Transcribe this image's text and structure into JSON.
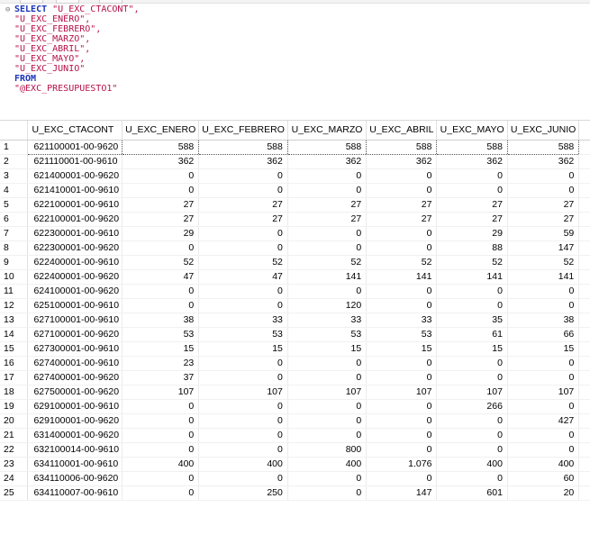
{
  "editor": {
    "lines": [
      {
        "kind": "select",
        "keyword": "SELECT",
        "text": "\"U_EXC_CTACONT\","
      },
      {
        "kind": "col",
        "text": "\"U_EXC_ENERO\","
      },
      {
        "kind": "col",
        "text": "\"U_EXC_FEBRERO\","
      },
      {
        "kind": "col",
        "text": "\"U_EXC_MARZO\","
      },
      {
        "kind": "col",
        "text": "\"U_EXC_ABRIL\","
      },
      {
        "kind": "col",
        "text": "\"U_EXC_MAYO\","
      },
      {
        "kind": "col",
        "text": "\"U_EXC_JUNIO\""
      },
      {
        "kind": "kw",
        "keyword": "FROM"
      },
      {
        "kind": "col",
        "text": "\"@EXC_PRESUPUESTO1\""
      }
    ]
  },
  "grid": {
    "columns": [
      "",
      "U_EXC_CTACONT",
      "U_EXC_ENERO",
      "U_EXC_FEBRERO",
      "U_EXC_MARZO",
      "U_EXC_ABRIL",
      "U_EXC_MAYO",
      "U_EXC_JUNIO"
    ],
    "rows": [
      [
        "1",
        "621100001-00-9620",
        "588",
        "588",
        "588",
        "588",
        "588",
        "588"
      ],
      [
        "2",
        "621110001-00-9610",
        "362",
        "362",
        "362",
        "362",
        "362",
        "362"
      ],
      [
        "3",
        "621400001-00-9620",
        "0",
        "0",
        "0",
        "0",
        "0",
        "0"
      ],
      [
        "4",
        "621410001-00-9610",
        "0",
        "0",
        "0",
        "0",
        "0",
        "0"
      ],
      [
        "5",
        "622100001-00-9610",
        "27",
        "27",
        "27",
        "27",
        "27",
        "27"
      ],
      [
        "6",
        "622100001-00-9620",
        "27",
        "27",
        "27",
        "27",
        "27",
        "27"
      ],
      [
        "7",
        "622300001-00-9610",
        "29",
        "0",
        "0",
        "0",
        "29",
        "59"
      ],
      [
        "8",
        "622300001-00-9620",
        "0",
        "0",
        "0",
        "0",
        "88",
        "147"
      ],
      [
        "9",
        "622400001-00-9610",
        "52",
        "52",
        "52",
        "52",
        "52",
        "52"
      ],
      [
        "10",
        "622400001-00-9620",
        "47",
        "47",
        "141",
        "141",
        "141",
        "141"
      ],
      [
        "11",
        "624100001-00-9620",
        "0",
        "0",
        "0",
        "0",
        "0",
        "0"
      ],
      [
        "12",
        "625100001-00-9610",
        "0",
        "0",
        "120",
        "0",
        "0",
        "0"
      ],
      [
        "13",
        "627100001-00-9610",
        "38",
        "33",
        "33",
        "33",
        "35",
        "38"
      ],
      [
        "14",
        "627100001-00-9620",
        "53",
        "53",
        "53",
        "53",
        "61",
        "66"
      ],
      [
        "15",
        "627300001-00-9610",
        "15",
        "15",
        "15",
        "15",
        "15",
        "15"
      ],
      [
        "16",
        "627400001-00-9610",
        "23",
        "0",
        "0",
        "0",
        "0",
        "0"
      ],
      [
        "17",
        "627400001-00-9620",
        "37",
        "0",
        "0",
        "0",
        "0",
        "0"
      ],
      [
        "18",
        "627500001-00-9620",
        "107",
        "107",
        "107",
        "107",
        "107",
        "107"
      ],
      [
        "19",
        "629100001-00-9610",
        "0",
        "0",
        "0",
        "0",
        "266",
        "0"
      ],
      [
        "20",
        "629100001-00-9620",
        "0",
        "0",
        "0",
        "0",
        "0",
        "427"
      ],
      [
        "21",
        "631400001-00-9620",
        "0",
        "0",
        "0",
        "0",
        "0",
        "0"
      ],
      [
        "22",
        "632100014-00-9610",
        "0",
        "0",
        "800",
        "0",
        "0",
        "0"
      ],
      [
        "23",
        "634110001-00-9610",
        "400",
        "400",
        "400",
        "1.076",
        "400",
        "400"
      ],
      [
        "24",
        "634110006-00-9620",
        "0",
        "0",
        "0",
        "0",
        "0",
        "60"
      ],
      [
        "25",
        "634110007-00-9610",
        "0",
        "250",
        "0",
        "147",
        "601",
        "20"
      ]
    ]
  },
  "colors": {
    "keyword": "#1c35b8",
    "string": "#b5124a",
    "grid_line": "#ececec",
    "selection_border": "#555555"
  }
}
